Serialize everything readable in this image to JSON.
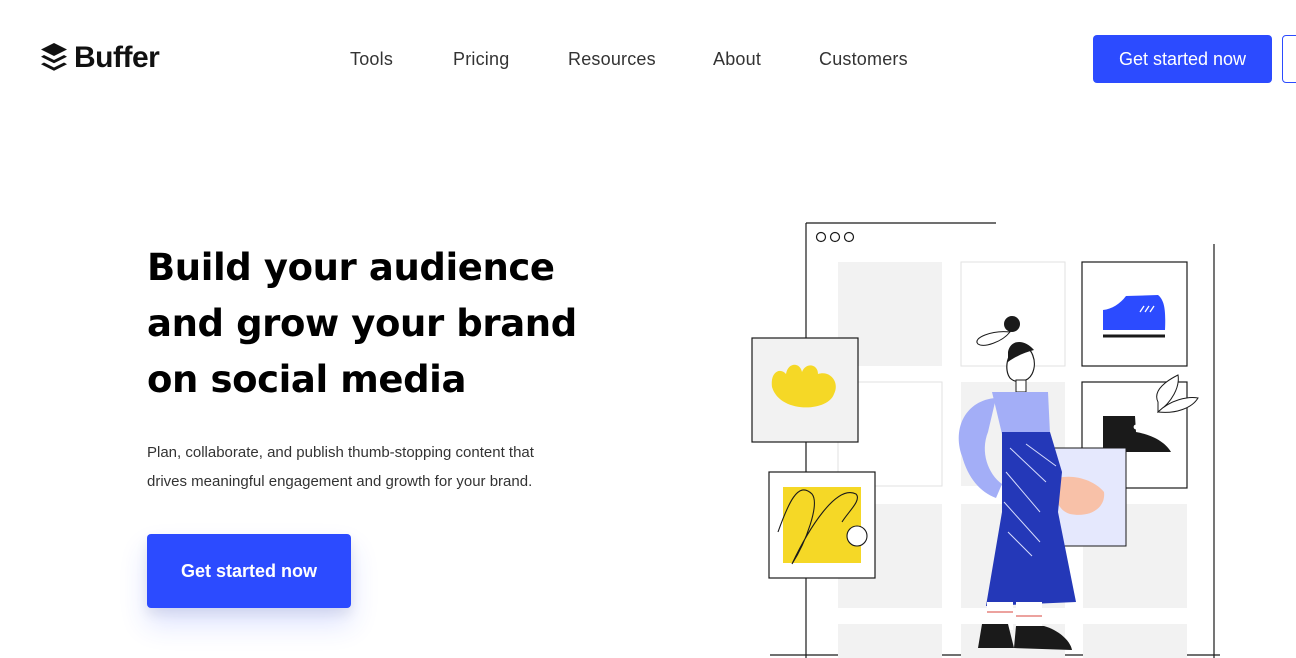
{
  "brand": {
    "name": "Buffer",
    "logo_icon": "stacked-layers-icon",
    "accent_color": "#2c4bff"
  },
  "nav": {
    "items": [
      {
        "label": "Tools"
      },
      {
        "label": "Pricing"
      },
      {
        "label": "Resources"
      },
      {
        "label": "About"
      },
      {
        "label": "Customers"
      }
    ]
  },
  "header": {
    "cta_label": "Get started now"
  },
  "hero": {
    "title_lines": [
      "Build your audience",
      "and grow your brand",
      "on social media"
    ],
    "subtitle_lines": [
      "Plan, collaborate, and publish thumb-stopping content that",
      "drives meaningful engagement and growth for your brand."
    ],
    "cta_label": "Get started now"
  },
  "illustration": {
    "subject": "person arranging social media posts on a grid",
    "colors": {
      "blue": "#2438b8",
      "lavender": "#a3aef7",
      "yellow": "#f5d826",
      "gray_tile": "#f2f2f2",
      "skin": "#f8c1a8",
      "ink": "#1a1a1a"
    }
  }
}
